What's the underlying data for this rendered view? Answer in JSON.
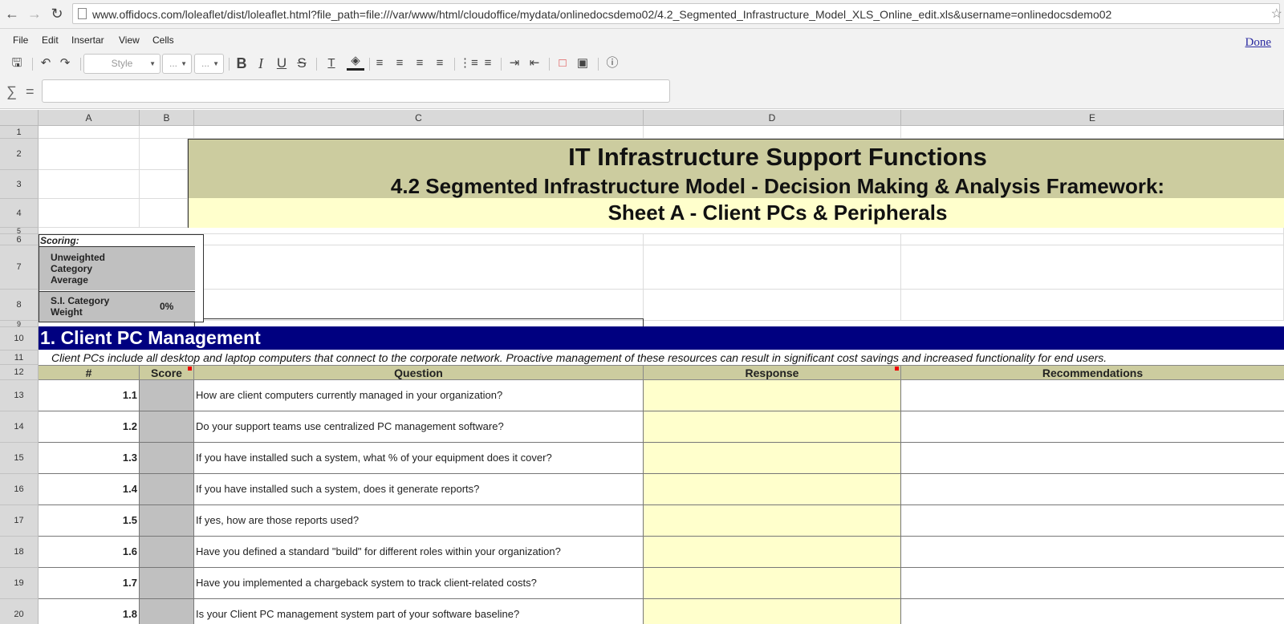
{
  "browser": {
    "url": "www.offidocs.com/loleaflet/dist/loleaflet.html?file_path=file:///var/www/html/cloudoffice/mydata/onlinedocsdemo02/4.2_Segmented_Infrastructure_Model_XLS_Online_edit.xls&username=onlinedocsdemo02"
  },
  "menu": {
    "items": [
      "File",
      "Edit",
      "Insertar",
      "View",
      "Cells"
    ],
    "done": "Done"
  },
  "toolbar": {
    "style_placeholder": "Style",
    "font_placeholder": "...",
    "size_placeholder": "..."
  },
  "columns": [
    "A",
    "B",
    "C",
    "D",
    "E"
  ],
  "rows": [
    "1",
    "2",
    "3",
    "4",
    "5",
    "6",
    "7",
    "8",
    "9",
    "10",
    "11",
    "12",
    "13",
    "14",
    "15",
    "16",
    "17",
    "18",
    "19",
    "20"
  ],
  "sheet": {
    "title": "IT Infrastructure Support Functions",
    "subtitle": "4.2 Segmented Infrastructure Model - Decision Making & Analysis Framework:",
    "sheet_name": "Sheet A - Client PCs & Peripherals",
    "scoring_label": "Scoring:",
    "unweighted_label": "Unweighted Category Average",
    "si_label": "S.I. Category Weight",
    "si_value": "0%",
    "section_title": "1. Client PC Management",
    "description": "Client PCs include all desktop and laptop computers that connect to the corporate network. Proactive management of these resources can result in significant cost savings and increased functionality for end users.",
    "headers": {
      "num": "#",
      "score": "Score",
      "question": "Question",
      "response": "Response",
      "recommendations": "Recommendations"
    },
    "questions": [
      {
        "num": "1.1",
        "text": "How are client computers currently managed in your organization?"
      },
      {
        "num": "1.2",
        "text": "Do your support teams use centralized PC management software?"
      },
      {
        "num": "1.3",
        "text": "If you have installed such a system, what % of your equipment does it cover?"
      },
      {
        "num": "1.4",
        "text": "If you have installed such a system, does it generate reports?"
      },
      {
        "num": "1.5",
        "text": "If yes, how are those reports used?"
      },
      {
        "num": "1.6",
        "text": "Have you defined a standard \"build\" for different roles within your organization?"
      },
      {
        "num": "1.7",
        "text": "Have you implemented a chargeback system to track client-related costs?"
      },
      {
        "num": "1.8",
        "text": "Is your Client PC management system part of your software baseline?"
      }
    ]
  }
}
